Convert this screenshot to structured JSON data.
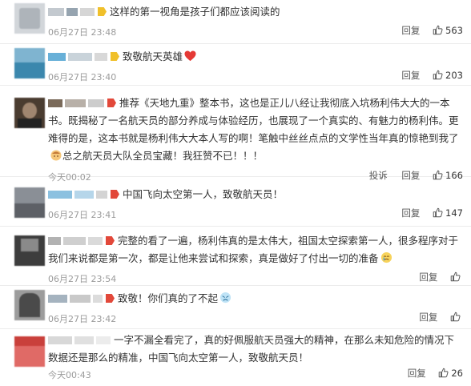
{
  "comments": [
    {
      "text": "这样的第一视角是孩子们都应该阅读的",
      "time": "06月27日 23:48",
      "reply_label": "回复",
      "likes": "563",
      "badge_color": "#f3c22b",
      "avatar_colors": [
        "#c8ccd0",
        "#9aa0a6"
      ],
      "name_colors": [
        "#bfc5cb",
        "#8fa0ad",
        "#d4d4d4"
      ]
    },
    {
      "text": "致敬航天英雄",
      "time": "06月27日 23:40",
      "reply_label": "回复",
      "likes": "203",
      "badge_color": "#f3c22b",
      "avatar_colors": [
        "#4aa0c8",
        "#2f7a9c"
      ],
      "name_colors": [
        "#6ab0d6",
        "#c9d3da",
        "#d6d6d6"
      ]
    },
    {
      "text": "推荐《天地九重》整本书，这也是正儿八经让我彻底入坑杨利伟大大的一本书。既揭秘了一名航天员的部分养成与体验经历，也展现了一个真实的、有魅力的杨利伟。更难得的是，这本书就是杨利伟大大本人写的啊！笔触中丝丝点点的文学性当年真的惊艳到我了",
      "text_tail": "总之航天员大队全员宝藏！我狂赞不已！！！",
      "time": "今天00:02",
      "report_label": "投诉",
      "reply_label": "回复",
      "likes": "166",
      "badge_color": "#e2483a",
      "avatar_colors": [
        "#5b4a3a",
        "#2b2b2b"
      ],
      "name_colors": [
        "#7a6a5a",
        "#b8b0a8",
        "#c8c8c8"
      ]
    },
    {
      "text": "中国飞向太空第一人，致敬航天员！",
      "time": "06月27日 23:41",
      "reply_label": "回复",
      "likes": "147",
      "badge_color": "#e2483a",
      "avatar_colors": [
        "#8a8f96",
        "#5d6066"
      ],
      "name_colors": [
        "#8cc1e0",
        "#b6d6ea",
        "#d0d0d0"
      ]
    },
    {
      "text": "完整的看了一遍，杨利伟真的是太伟大，祖国太空探索第一人，很多程序对于我们来说都是第一次，都是让他来尝试和探索，真是做好了付出一切的准备",
      "time": "06月27日 23:54",
      "reply_label": "回复",
      "likes": "",
      "badge_color": "#e2483a",
      "avatar_colors": [
        "#3d3d3d",
        "#8a8a8a"
      ],
      "name_colors": [
        "#b2b2b2",
        "#cfcfcf",
        "#dadada"
      ]
    },
    {
      "text": "致敬！你们真的了不起",
      "time": "06月27日 23:42",
      "reply_label": "回复",
      "likes": "",
      "badge_color": "#e2483a",
      "avatar_colors": [
        "#4a4a4a",
        "#a8a8a8"
      ],
      "name_colors": [
        "#a5b3bf",
        "#c9c9c9",
        "#dcdcdc"
      ]
    },
    {
      "text": "一字不漏全看完了，真的好佩服航天员强大的精神，在那么未知危险的情况下数据还是那么的精准，中国飞向太空第一人，致敬航天员！",
      "time": "今天00:43",
      "reply_label": "回复",
      "likes": "26",
      "badge_color": "#e2483a",
      "avatar_colors": [
        "#d9534f",
        "#b33a36"
      ],
      "name_colors": [
        "#d8d8d8",
        "#e0e0e0",
        "#ececec"
      ]
    }
  ]
}
